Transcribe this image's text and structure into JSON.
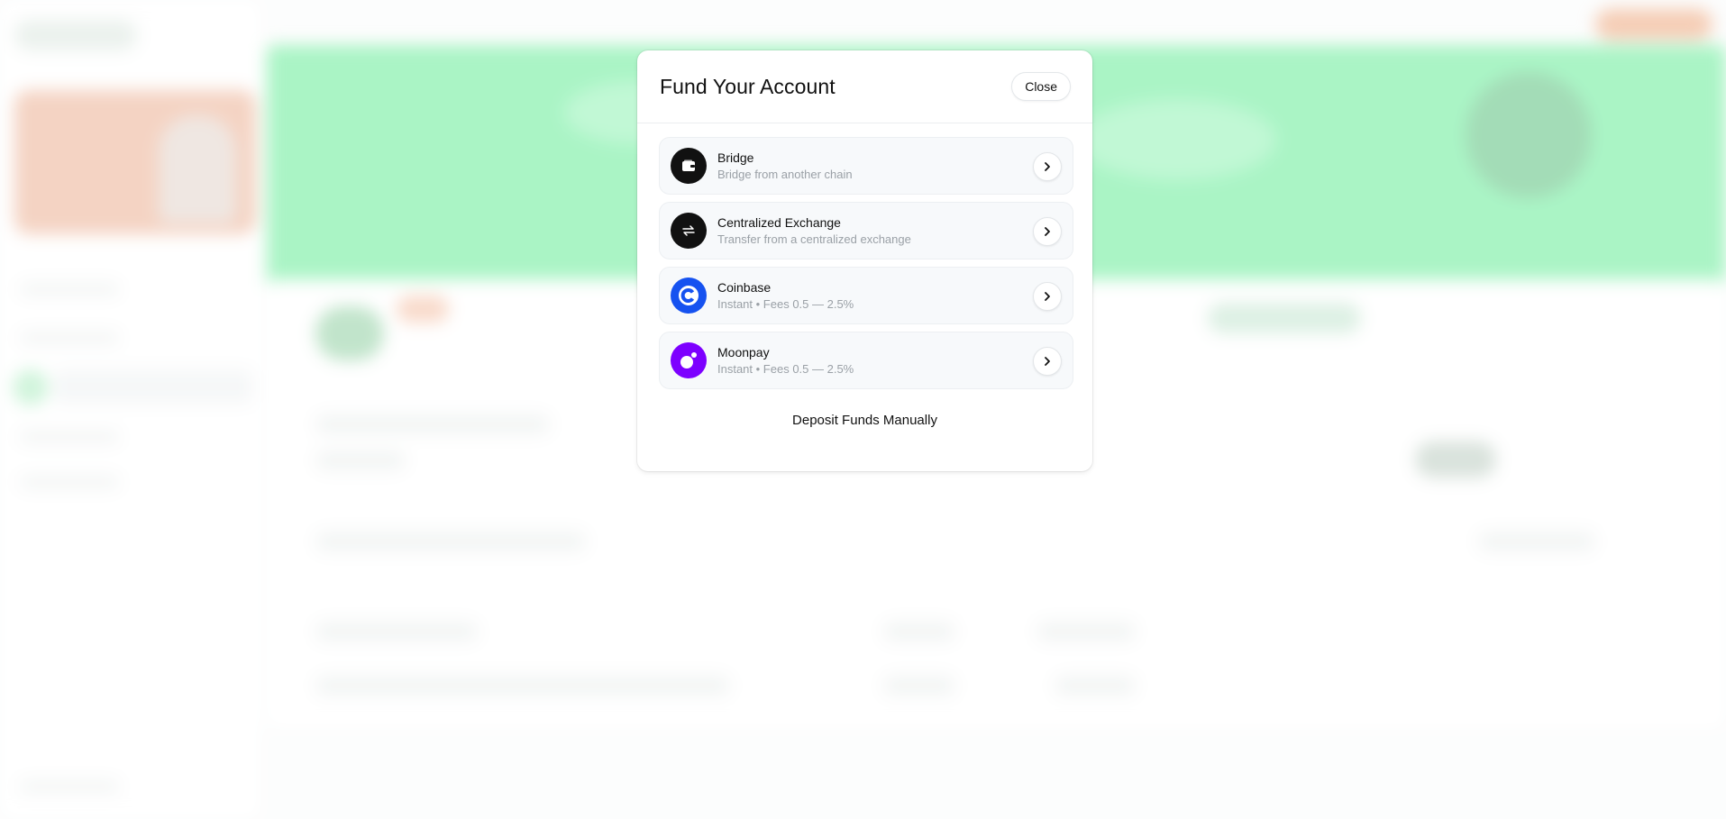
{
  "modal": {
    "title": "Fund Your Account",
    "close_label": "Close",
    "options": [
      {
        "title": "Bridge",
        "subtitle": "Bridge from another chain",
        "icon": "wallet-icon",
        "icon_bg": "#111111"
      },
      {
        "title": "Centralized Exchange",
        "subtitle": "Transfer from a centralized exchange",
        "icon": "exchange-arrows-icon",
        "icon_bg": "#111111"
      },
      {
        "title": "Coinbase",
        "subtitle": "Instant • Fees 0.5 — 2.5%",
        "icon": "coinbase-icon",
        "icon_bg": "#1652f0"
      },
      {
        "title": "Moonpay",
        "subtitle": "Instant • Fees 0.5 — 2.5%",
        "icon": "moonpay-icon",
        "icon_bg": "#7d00ff"
      }
    ],
    "deposit_manual_label": "Deposit Funds Manually"
  },
  "colors": {
    "accent_green": "#86f0ad",
    "coinbase_blue": "#1652f0",
    "moonpay_purple": "#7d00ff"
  }
}
